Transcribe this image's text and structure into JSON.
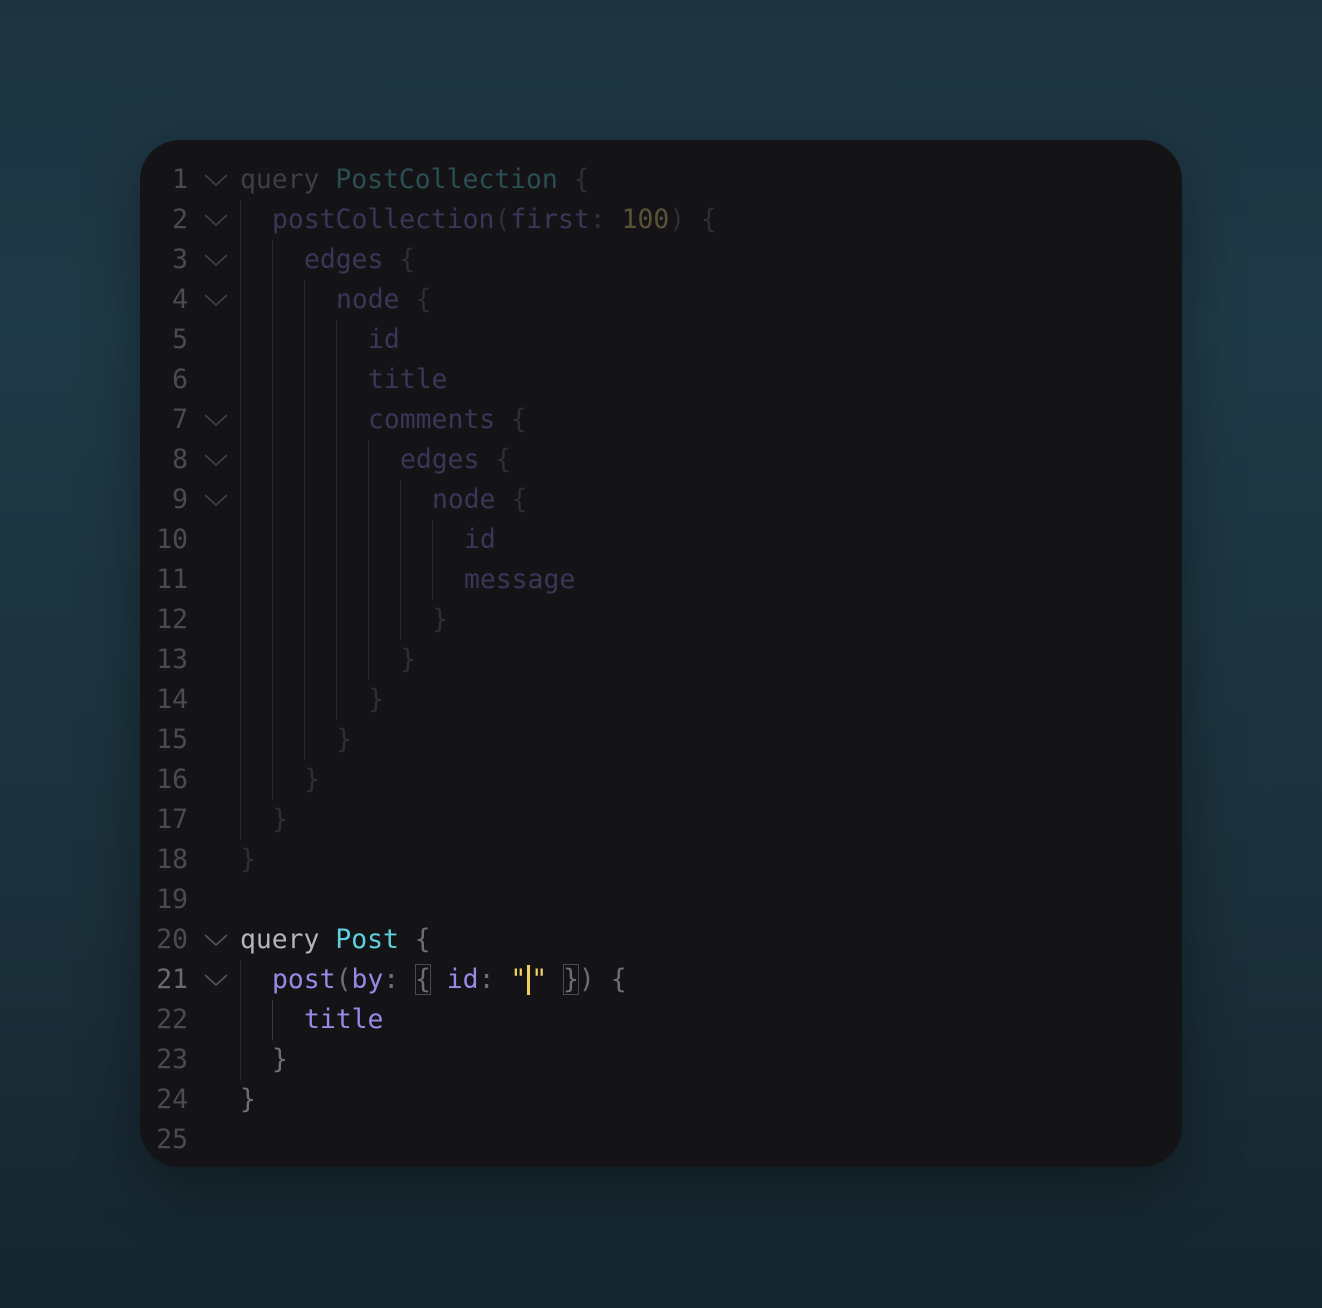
{
  "editor": {
    "language": "graphql",
    "active_line": 21,
    "cursor": {
      "line": 21,
      "inside": "string"
    },
    "colors": {
      "background": "#141416",
      "keyword": "#b4b4ba",
      "type": "#5fd0e0",
      "field": "#9b88e6",
      "string": "#f0d060",
      "number_dimmed": "#5a5236"
    },
    "lines": [
      {
        "n": "1",
        "fold": true,
        "indent": 0,
        "dim": true,
        "tokens": [
          [
            "kw",
            "query "
          ],
          [
            "type",
            "PostCollection"
          ],
          [
            "punc",
            " {"
          ]
        ]
      },
      {
        "n": "2",
        "fold": true,
        "indent": 1,
        "dim": true,
        "tokens": [
          [
            "field",
            "postCollection"
          ],
          [
            "punc",
            "("
          ],
          [
            "field",
            "first"
          ],
          [
            "punc",
            ": "
          ],
          [
            "num",
            "100"
          ],
          [
            "punc",
            ") {"
          ]
        ]
      },
      {
        "n": "3",
        "fold": true,
        "indent": 2,
        "dim": true,
        "tokens": [
          [
            "field",
            "edges"
          ],
          [
            "punc",
            " {"
          ]
        ]
      },
      {
        "n": "4",
        "fold": true,
        "indent": 3,
        "dim": true,
        "tokens": [
          [
            "field",
            "node"
          ],
          [
            "punc",
            " {"
          ]
        ]
      },
      {
        "n": "5",
        "fold": false,
        "indent": 4,
        "dim": true,
        "tokens": [
          [
            "field",
            "id"
          ]
        ]
      },
      {
        "n": "6",
        "fold": false,
        "indent": 4,
        "dim": true,
        "tokens": [
          [
            "field",
            "title"
          ]
        ]
      },
      {
        "n": "7",
        "fold": true,
        "indent": 4,
        "dim": true,
        "tokens": [
          [
            "field",
            "comments"
          ],
          [
            "punc",
            " {"
          ]
        ]
      },
      {
        "n": "8",
        "fold": true,
        "indent": 5,
        "dim": true,
        "tokens": [
          [
            "field",
            "edges"
          ],
          [
            "punc",
            " {"
          ]
        ]
      },
      {
        "n": "9",
        "fold": true,
        "indent": 6,
        "dim": true,
        "tokens": [
          [
            "field",
            "node"
          ],
          [
            "punc",
            " {"
          ]
        ]
      },
      {
        "n": "10",
        "fold": false,
        "indent": 7,
        "dim": true,
        "tokens": [
          [
            "field",
            "id"
          ]
        ]
      },
      {
        "n": "11",
        "fold": false,
        "indent": 7,
        "dim": true,
        "tokens": [
          [
            "field",
            "message"
          ]
        ]
      },
      {
        "n": "12",
        "fold": false,
        "indent": 6,
        "dim": true,
        "tokens": [
          [
            "punc",
            "}"
          ]
        ]
      },
      {
        "n": "13",
        "fold": false,
        "indent": 5,
        "dim": true,
        "tokens": [
          [
            "punc",
            "}"
          ]
        ]
      },
      {
        "n": "14",
        "fold": false,
        "indent": 4,
        "dim": true,
        "tokens": [
          [
            "punc",
            "}"
          ]
        ]
      },
      {
        "n": "15",
        "fold": false,
        "indent": 3,
        "dim": true,
        "tokens": [
          [
            "punc",
            "}"
          ]
        ]
      },
      {
        "n": "16",
        "fold": false,
        "indent": 2,
        "dim": true,
        "tokens": [
          [
            "punc",
            "}"
          ]
        ]
      },
      {
        "n": "17",
        "fold": false,
        "indent": 1,
        "dim": true,
        "tokens": [
          [
            "punc",
            "}"
          ]
        ]
      },
      {
        "n": "18",
        "fold": false,
        "indent": 0,
        "dim": true,
        "tokens": [
          [
            "punc",
            "}"
          ]
        ]
      },
      {
        "n": "19",
        "fold": false,
        "indent": 0,
        "dim": true,
        "tokens": []
      },
      {
        "n": "20",
        "fold": true,
        "indent": 0,
        "dim": false,
        "tokens": [
          [
            "kw",
            "query "
          ],
          [
            "type",
            "Post"
          ],
          [
            "punc",
            " {"
          ]
        ]
      },
      {
        "n": "21",
        "fold": true,
        "indent": 1,
        "dim": false,
        "tokens": [
          [
            "field",
            "post"
          ],
          [
            "punc",
            "("
          ],
          [
            "field",
            "by"
          ],
          [
            "punc",
            ": "
          ],
          [
            "match",
            "{"
          ],
          [
            "punc",
            " "
          ],
          [
            "field",
            "id"
          ],
          [
            "punc",
            ": "
          ],
          [
            "str",
            "\""
          ],
          [
            "cursor",
            ""
          ],
          [
            "str",
            "\""
          ],
          [
            "punc",
            " "
          ],
          [
            "match",
            "}"
          ],
          [
            "punc",
            ") {"
          ]
        ]
      },
      {
        "n": "22",
        "fold": false,
        "indent": 2,
        "dim": false,
        "tokens": [
          [
            "field",
            "title"
          ]
        ]
      },
      {
        "n": "23",
        "fold": false,
        "indent": 1,
        "dim": false,
        "tokens": [
          [
            "punc",
            "}"
          ]
        ]
      },
      {
        "n": "24",
        "fold": false,
        "indent": 0,
        "dim": false,
        "tokens": [
          [
            "punc",
            "}"
          ]
        ]
      },
      {
        "n": "25",
        "fold": false,
        "indent": 0,
        "dim": false,
        "tokens": []
      }
    ],
    "guides": [
      {
        "level": 0,
        "from": 2,
        "to": 17,
        "active": false
      },
      {
        "level": 1,
        "from": 3,
        "to": 16,
        "active": false
      },
      {
        "level": 2,
        "from": 4,
        "to": 15,
        "active": false
      },
      {
        "level": 3,
        "from": 5,
        "to": 14,
        "active": false
      },
      {
        "level": 4,
        "from": 8,
        "to": 13,
        "active": false
      },
      {
        "level": 5,
        "from": 9,
        "to": 12,
        "active": false
      },
      {
        "level": 6,
        "from": 10,
        "to": 11,
        "active": false
      },
      {
        "level": 0,
        "from": 21,
        "to": 23,
        "active": false
      },
      {
        "level": 1,
        "from": 22,
        "to": 22,
        "active": true
      }
    ]
  }
}
